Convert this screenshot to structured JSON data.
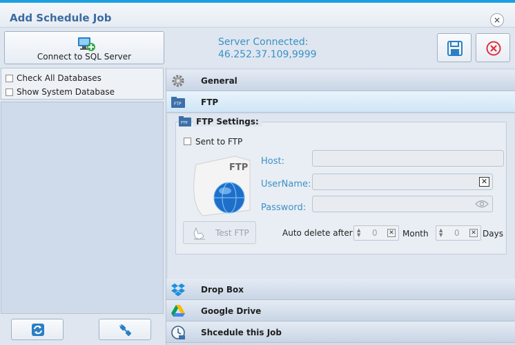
{
  "window": {
    "title": "Add Schedule Job",
    "close_glyph": "×"
  },
  "toolbar": {
    "connect_label": "Connect to SQL Server",
    "status_line1": "Server Connected:",
    "status_line2": "46.252.37.109,9999"
  },
  "left": {
    "check_all": "Check All Databases",
    "show_system": "Show System Database"
  },
  "sections": {
    "general": "General",
    "ftp": "FTP",
    "dropbox": "Drop Box",
    "gdrive": "Google Drive",
    "schedule": "Shcedule this Job"
  },
  "ftp": {
    "group_title": "FTP Settings:",
    "sent_to_ftp": "Sent to FTP",
    "ftp_badge": "FTP",
    "host_label": "Host:",
    "username_label": "UserName:",
    "password_label": "Password:",
    "host_value": "",
    "username_value": "",
    "password_value": "",
    "clear_glyph": "✕",
    "test_label": "Test FTP",
    "auto_delete_label": "Auto delete after:",
    "month_value": "0",
    "month_unit": "Month",
    "days_value": "0",
    "days_unit": "Days"
  },
  "icons": {
    "connect": "computer-plus-icon",
    "save": "floppy-disk-icon",
    "cancel": "cancel-circle-icon",
    "refresh": "refresh-icon",
    "plug": "plug-icon",
    "general": "gear-icon",
    "ftp": "ftp-folder-icon",
    "dropbox": "dropbox-icon",
    "gdrive": "google-drive-icon",
    "schedule": "clock-icon",
    "show_password": "eye-icon"
  },
  "colors": {
    "accent": "#1ba1e2",
    "title": "#3b6aa0",
    "label_blue": "#3a90c8",
    "cancel_red": "#e0303a"
  }
}
